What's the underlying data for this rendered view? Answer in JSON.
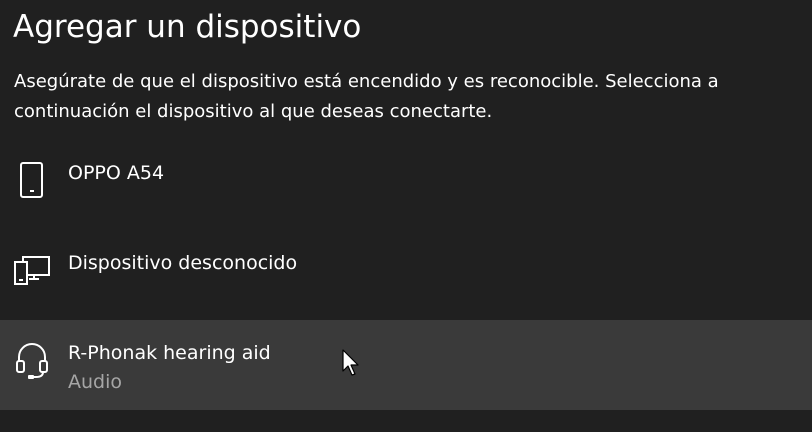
{
  "dialog": {
    "title": "Agregar un dispositivo",
    "description": "Asegúrate de que el dispositivo está encendido y es reconocible. Selecciona a continuación el dispositivo al que deseas conectarte."
  },
  "devices": [
    {
      "name": "OPPO A54",
      "subtitle": "",
      "icon": "phone-icon",
      "selected": false
    },
    {
      "name": "Dispositivo desconocido",
      "subtitle": "",
      "icon": "devices-icon",
      "selected": false
    },
    {
      "name": "R-Phonak hearing aid",
      "subtitle": "Audio",
      "icon": "headset-icon",
      "selected": true
    }
  ],
  "colors": {
    "background": "#202020",
    "selected_row": "#3a3a3a",
    "primary_text": "#ffffff",
    "secondary_text": "#a6a6a6"
  }
}
